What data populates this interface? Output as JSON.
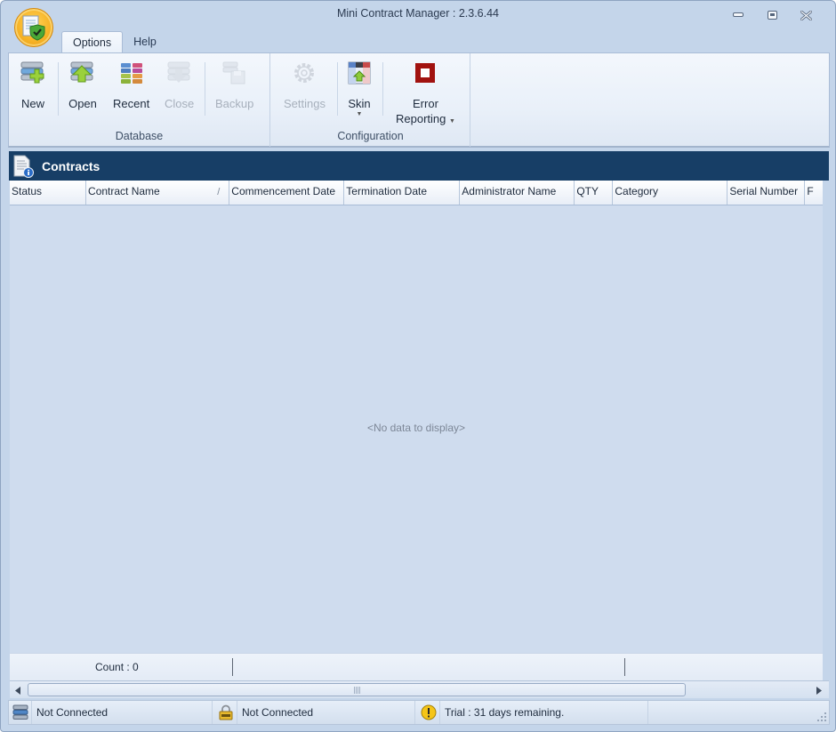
{
  "window": {
    "title": "Mini Contract Manager : 2.3.6.44",
    "controls": [
      "minimize",
      "restore",
      "close"
    ]
  },
  "app_button": {
    "icon": "contract-shield-icon"
  },
  "tabs": [
    {
      "label": "Options",
      "active": true
    },
    {
      "label": "Help",
      "active": false
    }
  ],
  "ribbon": {
    "groups": [
      {
        "label": "Database",
        "buttons": [
          {
            "label": "New",
            "icon": "database-add-icon",
            "enabled": true
          },
          {
            "label": "Open",
            "icon": "database-open-icon",
            "enabled": true
          },
          {
            "label": "Recent",
            "icon": "recent-databases-icon",
            "enabled": true
          },
          {
            "label": "Close",
            "icon": "database-close-icon",
            "enabled": false
          },
          {
            "label": "Backup",
            "icon": "backup-icon",
            "enabled": false
          }
        ]
      },
      {
        "label": "Configuration",
        "buttons": [
          {
            "label": "Settings",
            "icon": "gear-icon",
            "enabled": false
          },
          {
            "label": "Skin",
            "icon": "skin-icon",
            "enabled": true,
            "dropdown": true
          },
          {
            "label_line1": "Error",
            "label_line2": "Reporting",
            "icon": "error-reporting-icon",
            "enabled": true,
            "dropdown": true
          }
        ]
      }
    ]
  },
  "panel": {
    "title": "Contracts",
    "icon": "contract-info-icon"
  },
  "grid": {
    "columns": [
      {
        "label": "Status"
      },
      {
        "label": "Contract Name",
        "sort": "/"
      },
      {
        "label": "Commencement Date"
      },
      {
        "label": "Termination Date"
      },
      {
        "label": "Administrator Name"
      },
      {
        "label": "QTY"
      },
      {
        "label": "Category"
      },
      {
        "label": "Serial Number"
      },
      {
        "label": "F"
      }
    ],
    "rows": [],
    "empty_text": "<No data to display>",
    "footer_count": "Count : 0"
  },
  "statusbar": {
    "db_status": "Not Connected",
    "lock_status": "Not Connected",
    "trial_text": "Trial : 31 days remaining."
  },
  "colors": {
    "header_bg": "#173e66",
    "frame_bg": "#c4d5ea",
    "grid_bg": "#cfdcee",
    "orb": "#f7b428",
    "error_icon": "#a1120f"
  }
}
